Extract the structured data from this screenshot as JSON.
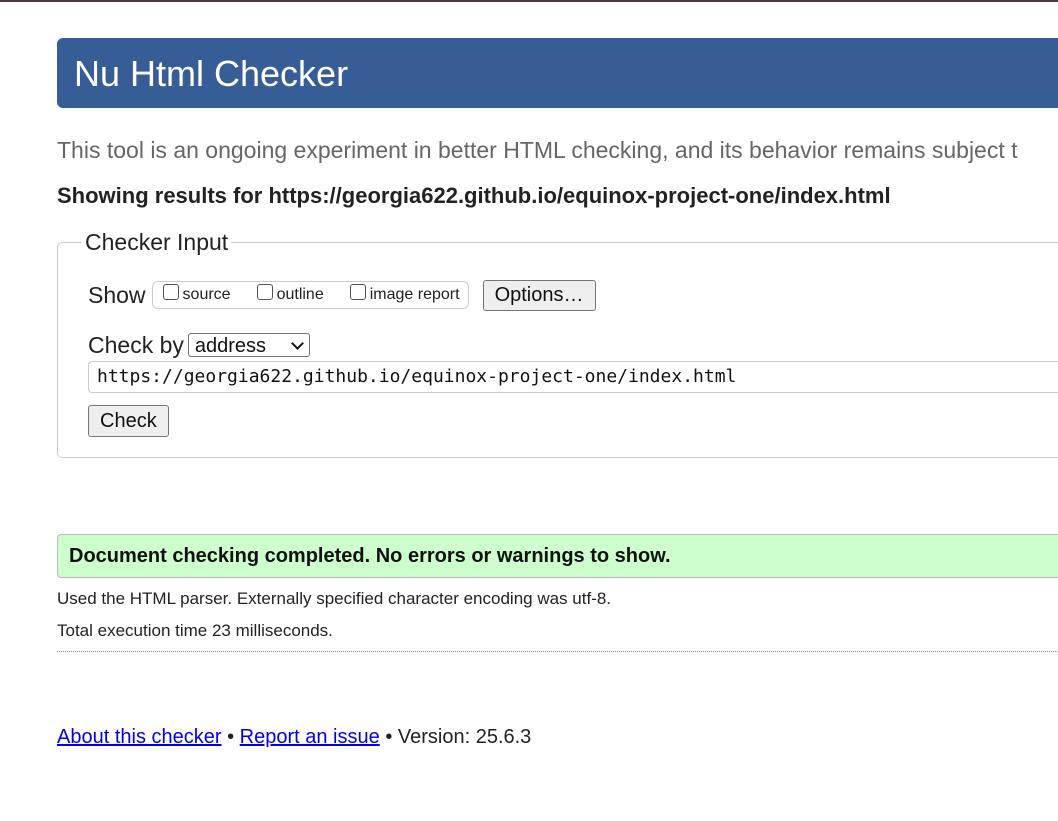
{
  "header": {
    "title": "Nu Html Checker"
  },
  "intro": "This tool is an ongoing experiment in better HTML checking, and its behavior remains subject t",
  "results_for": "Showing results for https://georgia622.github.io/equinox-project-one/index.html",
  "checker_input": {
    "legend": "Checker Input",
    "show_label": "Show",
    "show_options": {
      "source": "source",
      "outline": "outline",
      "image_report": "image report"
    },
    "options_button": "Options…",
    "check_by_label": "Check by",
    "check_by_selected": "address",
    "url_value": "https://georgia622.github.io/equinox-project-one/index.html",
    "check_button": "Check"
  },
  "result": {
    "message": "Document checking completed. No errors or warnings to show.",
    "colors": {
      "success_bg": "#ccffcc",
      "header_bg": "#365d95"
    }
  },
  "details": {
    "parser": "Used the HTML parser. Externally specified character encoding was utf-8.",
    "time": "Total execution time 23 milliseconds."
  },
  "footer": {
    "about_link": "About this checker",
    "separator": "•",
    "report_link": "Report an issue",
    "version": "• Version: 25.6.3"
  }
}
